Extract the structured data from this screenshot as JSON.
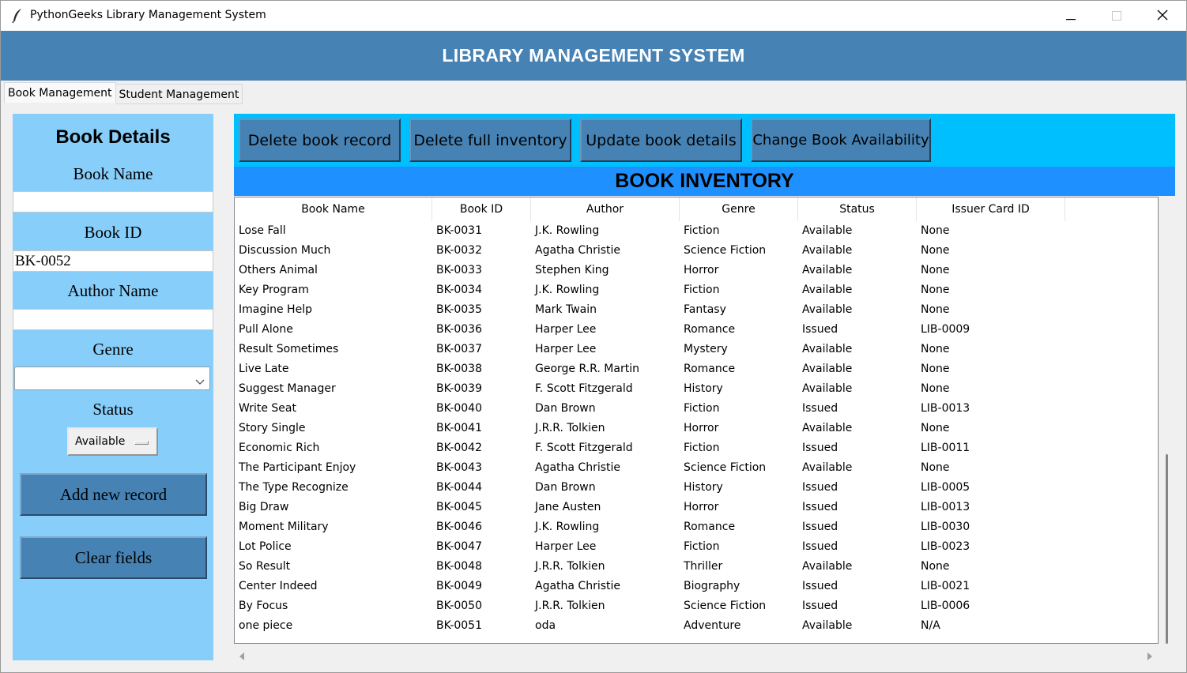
{
  "window": {
    "title": "PythonGeeks Library Management System"
  },
  "header": {
    "title": "LIBRARY MANAGEMENT SYSTEM"
  },
  "tabs": [
    {
      "label": "Book Management"
    },
    {
      "label": "Student Management"
    }
  ],
  "form": {
    "title": "Book Details",
    "book_name_label": "Book Name",
    "book_name_value": "",
    "book_id_label": "Book ID",
    "book_id_value": "BK-0052",
    "author_label": "Author Name",
    "author_value": "",
    "genre_label": "Genre",
    "genre_value": "",
    "status_label": "Status",
    "status_value": "Available",
    "add_button": "Add new record",
    "clear_button": "Clear fields"
  },
  "toolbar": {
    "delete_record": "Delete book record",
    "delete_inventory": "Delete full inventory",
    "update_details": "Update book details",
    "change_availability": "Change Book Availability"
  },
  "inventory": {
    "title": "BOOK INVENTORY",
    "columns": [
      "Book Name",
      "Book ID",
      "Author",
      "Genre",
      "Status",
      "Issuer Card ID"
    ],
    "rows": [
      [
        "Lose Fall",
        "BK-0031",
        "J.K. Rowling",
        "Fiction",
        "Available",
        "None"
      ],
      [
        "Discussion Much",
        "BK-0032",
        "Agatha Christie",
        "Science Fiction",
        "Available",
        "None"
      ],
      [
        "Others Animal",
        "BK-0033",
        "Stephen King",
        "Horror",
        "Available",
        "None"
      ],
      [
        "Key Program",
        "BK-0034",
        "J.K. Rowling",
        "Fiction",
        "Available",
        "None"
      ],
      [
        "Imagine Help",
        "BK-0035",
        "Mark Twain",
        "Fantasy",
        "Available",
        "None"
      ],
      [
        "Pull Alone",
        "BK-0036",
        "Harper Lee",
        "Romance",
        "Issued",
        "LIB-0009"
      ],
      [
        "Result Sometimes",
        "BK-0037",
        "Harper Lee",
        "Mystery",
        "Available",
        "None"
      ],
      [
        "Live Late",
        "BK-0038",
        "George R.R. Martin",
        "Romance",
        "Available",
        "None"
      ],
      [
        "Suggest Manager",
        "BK-0039",
        "F. Scott Fitzgerald",
        "History",
        "Available",
        "None"
      ],
      [
        "Write Seat",
        "BK-0040",
        "Dan Brown",
        "Fiction",
        "Issued",
        "LIB-0013"
      ],
      [
        "Story Single",
        "BK-0041",
        "J.R.R. Tolkien",
        "Horror",
        "Available",
        "None"
      ],
      [
        "Economic Rich",
        "BK-0042",
        "F. Scott Fitzgerald",
        "Fiction",
        "Issued",
        "LIB-0011"
      ],
      [
        "The Participant Enjoy",
        "BK-0043",
        "Agatha Christie",
        "Science Fiction",
        "Available",
        "None"
      ],
      [
        "The Type Recognize",
        "BK-0044",
        "Dan Brown",
        "History",
        "Issued",
        "LIB-0005"
      ],
      [
        "Big Draw",
        "BK-0045",
        "Jane Austen",
        "Horror",
        "Issued",
        "LIB-0013"
      ],
      [
        "Moment Military",
        "BK-0046",
        "J.K. Rowling",
        "Romance",
        "Issued",
        "LIB-0030"
      ],
      [
        "Lot Police",
        "BK-0047",
        "Harper Lee",
        "Fiction",
        "Issued",
        "LIB-0023"
      ],
      [
        "So Result",
        "BK-0048",
        "J.R.R. Tolkien",
        "Thriller",
        "Available",
        "None"
      ],
      [
        "Center Indeed",
        "BK-0049",
        "Agatha Christie",
        "Biography",
        "Issued",
        "LIB-0021"
      ],
      [
        "By Focus",
        "BK-0050",
        "J.R.R. Tolkien",
        "Science Fiction",
        "Issued",
        "LIB-0006"
      ],
      [
        "one piece",
        "BK-0051",
        "oda",
        "Adventure",
        "Available",
        "N/A"
      ]
    ]
  },
  "colors": {
    "header_bg": "#4682b4",
    "panel_bg": "#87cefa",
    "toolbar_bg": "#00bfff",
    "inventory_header_bg": "#1e90ff",
    "button_bg": "#4682b4"
  },
  "icons": [
    "feather-icon",
    "minimize-icon",
    "maximize-icon",
    "close-icon",
    "chevron-down-icon",
    "scroll-left-icon",
    "scroll-right-icon"
  ]
}
